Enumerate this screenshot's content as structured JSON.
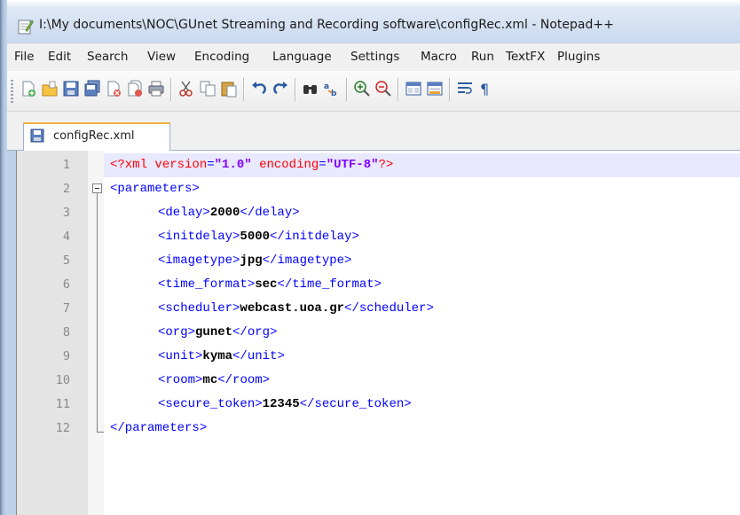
{
  "window": {
    "title": "I:\\My documents\\NOC\\GUnet Streaming and Recording software\\configRec.xml - Notepad++"
  },
  "menu": [
    "File",
    "Edit",
    "Search",
    "View",
    "Encoding",
    "Language",
    "Settings",
    "Macro",
    "Run",
    "TextFX",
    "Plugins"
  ],
  "toolbar": {
    "buttons": [
      "new-file-icon",
      "open-file-icon",
      "save-icon",
      "save-all-icon",
      "close-icon",
      "close-all-icon",
      "print-icon",
      "cut-icon",
      "copy-icon",
      "paste-icon",
      "undo-icon",
      "redo-icon",
      "find-icon",
      "replace-icon",
      "zoom-in-icon",
      "zoom-out-icon",
      "sync-vertical-icon",
      "sync-horizontal-icon",
      "word-wrap-icon",
      "show-all-chars-icon"
    ]
  },
  "tabs": [
    {
      "label": "configRec.xml",
      "active": true
    }
  ],
  "editor": {
    "line_numbers": [
      "1",
      "2",
      "3",
      "4",
      "5",
      "6",
      "7",
      "8",
      "9",
      "10",
      "11",
      "12"
    ],
    "lines": {
      "l1": {
        "pi_open": "<?xml ",
        "attr1": "version",
        "eq1": "=",
        "val1": "\"1.0\"",
        "sp": " ",
        "attr2": "encoding",
        "eq2": "=",
        "val2": "\"UTF-8\"",
        "pi_close": "?>"
      },
      "l2": {
        "tag": "<parameters>"
      },
      "l3": {
        "open": "<delay>",
        "text": "2000",
        "close": "</delay>"
      },
      "l4": {
        "open": "<initdelay>",
        "text": "5000",
        "close": "</initdelay>"
      },
      "l5": {
        "open": "<imagetype>",
        "text": "jpg",
        "close": "</imagetype>"
      },
      "l6": {
        "open": "<time_format>",
        "text": "sec",
        "close": "</time_format>"
      },
      "l7": {
        "open": "<scheduler>",
        "text": "webcast.uoa.gr",
        "close": "</scheduler>"
      },
      "l8": {
        "open": "<org>",
        "text": "gunet",
        "close": "</org>"
      },
      "l9": {
        "open": "<unit>",
        "text": "kyma",
        "close": "</unit>"
      },
      "l10": {
        "open": "<room>",
        "text": "mc",
        "close": "</room>"
      },
      "l11": {
        "open": "<secure_token>",
        "text": "12345",
        "close": "</secure_token>"
      },
      "l12": {
        "tag": "</parameters>"
      }
    }
  },
  "colors": {
    "tag": "#0000ff",
    "attribute": "#ff0000",
    "string": "#8000ff",
    "current_line": "#e8e8ff"
  }
}
